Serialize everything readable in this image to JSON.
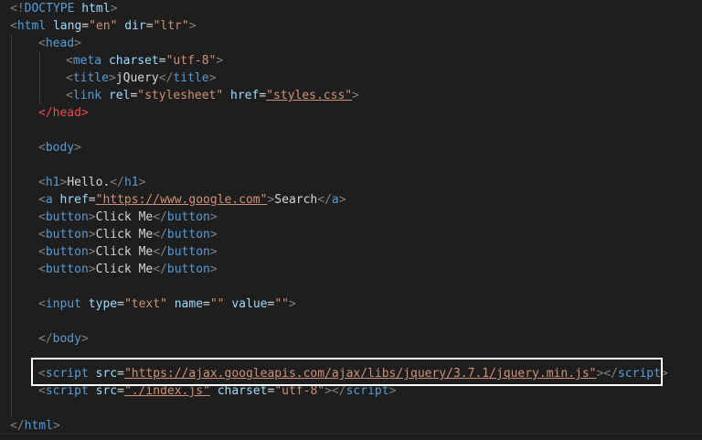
{
  "code": {
    "doctype": {
      "open": "<!",
      "keyword": "DOCTYPE",
      "name": "html",
      "close": ">"
    },
    "html_open": {
      "tag": "html",
      "attr1": "lang",
      "val1": "\"en\"",
      "attr2": "dir",
      "val2": "\"ltr\""
    },
    "head_open": {
      "tag": "head"
    },
    "meta": {
      "tag": "meta",
      "attr": "charset",
      "val": "\"utf-8\""
    },
    "title": {
      "tag": "title",
      "text": "jQuery"
    },
    "link": {
      "tag": "link",
      "attr1": "rel",
      "val1": "\"stylesheet\"",
      "attr2": "href",
      "val2": "\"styles.css\""
    },
    "head_close": {
      "tag": "head"
    },
    "body_open": {
      "tag": "body"
    },
    "h1": {
      "tag": "h1",
      "text": "Hello."
    },
    "anchor": {
      "tag": "a",
      "attr": "href",
      "val": "\"https://www.google.com\"",
      "text": "Search"
    },
    "buttons": [
      {
        "tag": "button",
        "text": "Click Me"
      },
      {
        "tag": "button",
        "text": "Click Me"
      },
      {
        "tag": "button",
        "text": "Click Me"
      },
      {
        "tag": "button",
        "text": "Click Me"
      }
    ],
    "input": {
      "tag": "input",
      "attr1": "type",
      "val1": "\"text\"",
      "attr2": "name",
      "val2": "\"\"",
      "attr3": "value",
      "val3": "\"\""
    },
    "body_close": {
      "tag": "body"
    },
    "script1": {
      "tag": "script",
      "attr": "src",
      "val": "\"https://ajax.googleapis.com/ajax/libs/jquery/3.7.1/jquery.min.js\""
    },
    "script2": {
      "tag": "script",
      "attr1": "src",
      "val1": "\"./index.js\"",
      "attr2": "charset",
      "val2": "\"utf-8\""
    },
    "html_close": {
      "tag": "html"
    }
  },
  "colors": {
    "background": "#1e1e1e",
    "tag": "#569cd6",
    "attribute": "#9cdcfe",
    "string": "#ce9178",
    "punctuation": "#808080",
    "text": "#d4d4d4",
    "highlight_border": "#ffffff"
  }
}
